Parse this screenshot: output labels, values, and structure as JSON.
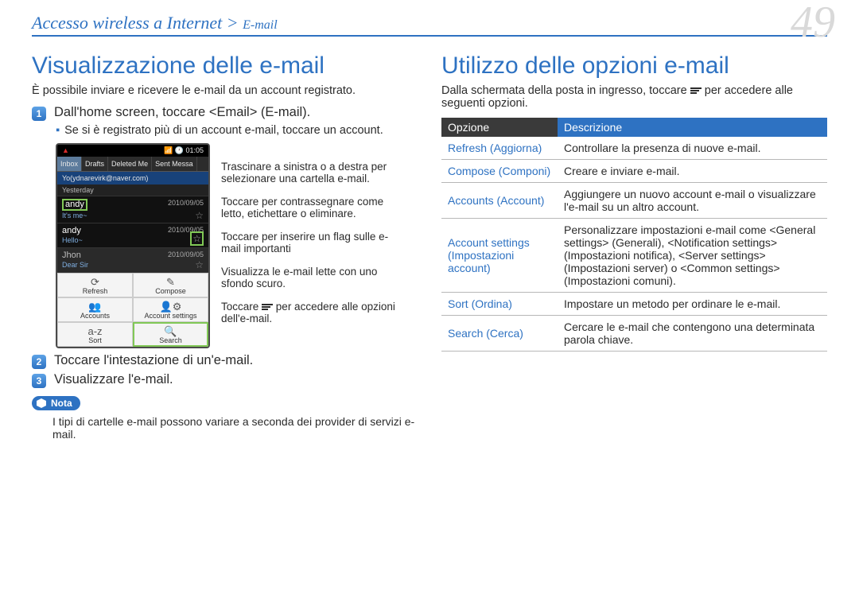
{
  "header": {
    "breadcrumb_main": "Accesso wireless a Internet >",
    "breadcrumb_sub": "E-mail",
    "page_number": "49"
  },
  "left": {
    "title": "Visualizzazione delle e-mail",
    "intro": "È possibile inviare e ricevere le e-mail da un account registrato.",
    "step1": "Dall'home screen, toccare <Email> (E-mail).",
    "bullet1": "Se si è registrato più di un account e-mail, toccare un account.",
    "callouts": {
      "c1": "Trascinare a sinistra o a destra per selezionare una cartella e-mail.",
      "c2": "Toccare per contrassegnare come letto, etichettare o eliminare.",
      "c3": "Toccare per inserire un flag sulle e-mail importanti",
      "c4": "Visualizza le e-mail lette con uno sfondo scuro.",
      "c5a": "Toccare ",
      "c5b": " per accedere alle opzioni dell'e-mail."
    },
    "step2": "Toccare l'intestazione di un'e-mail.",
    "step3": "Visualizzare l'e-mail.",
    "note_label": "Nota",
    "note_text": "I tipi di cartelle e-mail possono variare a seconda dei provider di servizi e-mail."
  },
  "right": {
    "title": "Utilizzo delle opzioni e-mail",
    "intro_a": "Dalla schermata della posta in ingresso, toccare ",
    "intro_b": " per accedere alle seguenti opzioni.",
    "table": {
      "h1": "Opzione",
      "h2": "Descrizione",
      "rows": [
        {
          "opt": "Refresh (Aggiorna)",
          "desc": "Controllare la presenza di nuove e-mail."
        },
        {
          "opt": "Compose (Componi)",
          "desc": "Creare e inviare e-mail."
        },
        {
          "opt": "Accounts (Account)",
          "desc": "Aggiungere un nuovo account e-mail o visualizzare l'e-mail su un altro account."
        },
        {
          "opt": "Account settings (Impostazioni account)",
          "desc": "Personalizzare impostazioni e-mail come <General settings> (Generali), <Notification settings> (Impostazioni notifica), <Server settings> (Impostazioni server) o <Common settings> (Impostazioni comuni)."
        },
        {
          "opt": "Sort (Ordina)",
          "desc": "Impostare un metodo per ordinare le e-mail."
        },
        {
          "opt": "Search (Cerca)",
          "desc": "Cercare le e-mail che contengono una determinata parola chiave."
        }
      ]
    }
  },
  "phone": {
    "time": "01:05",
    "tabs": [
      "Inbox",
      "Drafts",
      "Deleted Me",
      "Sent Messa"
    ],
    "account": "Yo(ydnarevirk@naver.com)",
    "day": "Yesterday",
    "rows": [
      {
        "name": "andy",
        "date": "2010/09/05",
        "preview": "It's me~"
      },
      {
        "name": "andy",
        "date": "2010/09/05",
        "preview": "Hello~"
      },
      {
        "name": "Jhon",
        "date": "2010/09/05",
        "preview": "Dear Sir"
      }
    ],
    "menu": {
      "refresh": "Refresh",
      "compose": "Compose",
      "accounts": "Accounts",
      "settings": "Account settings",
      "sort": "Sort",
      "search": "Search"
    }
  }
}
